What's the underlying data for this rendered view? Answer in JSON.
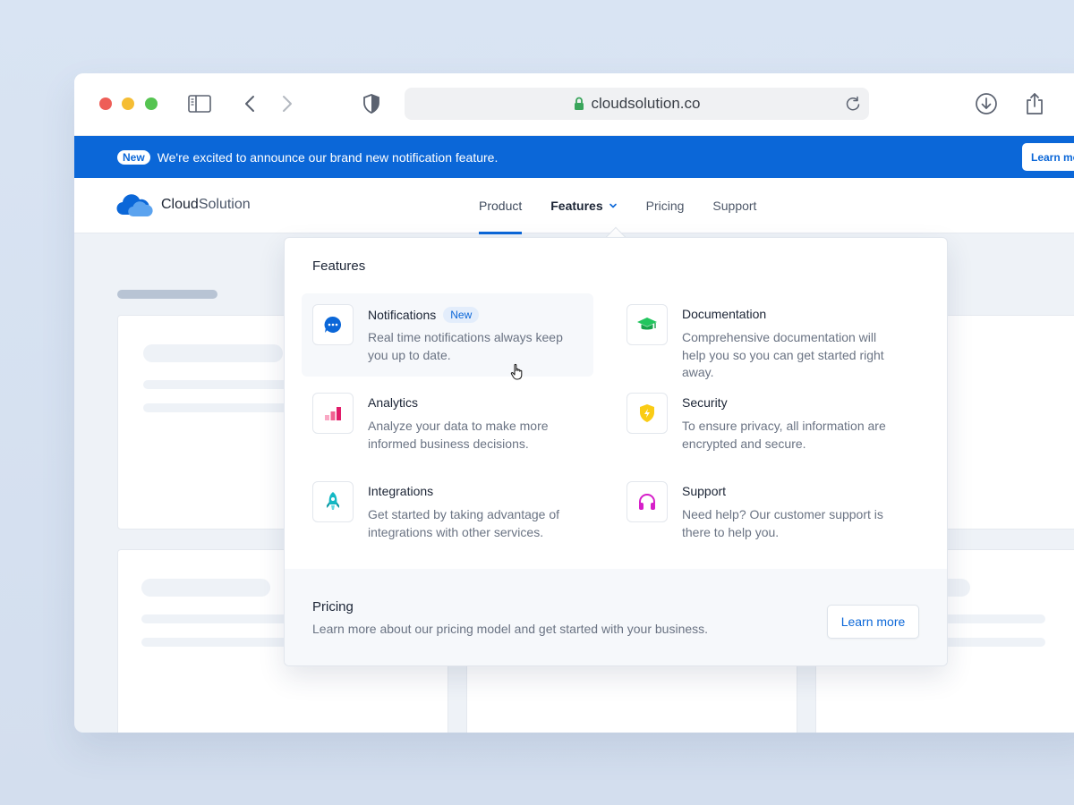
{
  "browser": {
    "url": "cloudsolution.co"
  },
  "banner": {
    "badge": "New",
    "message": "We're excited to announce our brand new notification feature.",
    "button": "Learn mo"
  },
  "site": {
    "logo_bold": "Cloud",
    "logo_light": "Solution",
    "nav": [
      "Product",
      "Features",
      "Pricing",
      "Support"
    ]
  },
  "dropdown": {
    "title": "Features",
    "items": [
      {
        "title": "Notifications",
        "badge": "New",
        "desc": "Real time notifications always keep you up to date.",
        "icon": "chat-bubble-icon",
        "color": "#0b67d8"
      },
      {
        "title": "Documentation",
        "badge": "",
        "desc": "Comprehensive documentation will help you so you can get started right away.",
        "icon": "graduation-cap-icon",
        "color": "#22c55e"
      },
      {
        "title": "Analytics",
        "badge": "",
        "desc": "Analyze your data to make more informed business decisions.",
        "icon": "bar-chart-icon",
        "color": "#e11d6a"
      },
      {
        "title": "Security",
        "badge": "",
        "desc": "To ensure privacy, all information are encrypted and secure.",
        "icon": "shield-bolt-icon",
        "color": "#facc15"
      },
      {
        "title": "Integrations",
        "badge": "",
        "desc": "Get started by taking advantage of integrations with other services.",
        "icon": "rocket-icon",
        "color": "#14b8c4"
      },
      {
        "title": "Support",
        "badge": "",
        "desc": "Need help? Our customer support is there to help you.",
        "icon": "headphones-icon",
        "color": "#d61fc9"
      }
    ],
    "footer": {
      "title": "Pricing",
      "desc": "Learn more about our pricing model and get started with your business.",
      "button": "Learn more"
    }
  }
}
